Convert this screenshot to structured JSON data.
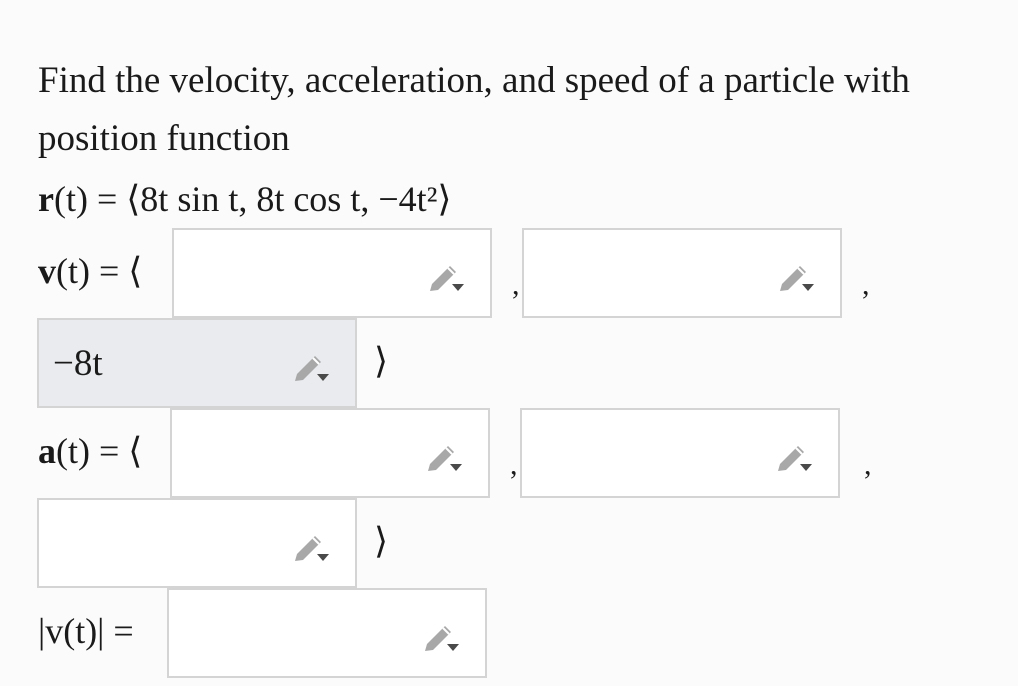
{
  "problem": {
    "text_line1": "Find the velocity, acceleration, and speed of a particle with",
    "text_line2": "position function"
  },
  "position_function": {
    "bold_var": "r",
    "rest": "(t) = ⟨8t sin t, 8t cos t, −4t²⟩"
  },
  "velocity": {
    "label_bold": "v",
    "label_rest": "(t) = ⟨",
    "inputs": [
      {
        "value": "",
        "filled": false
      },
      {
        "value": "",
        "filled": false
      },
      {
        "value": "−8t",
        "filled": true
      }
    ],
    "close": "⟩"
  },
  "acceleration": {
    "label_bold": "a",
    "label_rest": "(t) = ⟨",
    "inputs": [
      {
        "value": "",
        "filled": false
      },
      {
        "value": "",
        "filled": false
      },
      {
        "value": "",
        "filled": false
      }
    ],
    "close": "⟩"
  },
  "speed": {
    "label": "|v(t)| =",
    "input": {
      "value": ""
    }
  },
  "separator": ",",
  "icons": {
    "edit": "pencil-edit-icon"
  },
  "colors": {
    "box_border": "#d4d4d4",
    "filled_box_bg": "#e9ebee",
    "pencil": "#a8a8a8"
  }
}
